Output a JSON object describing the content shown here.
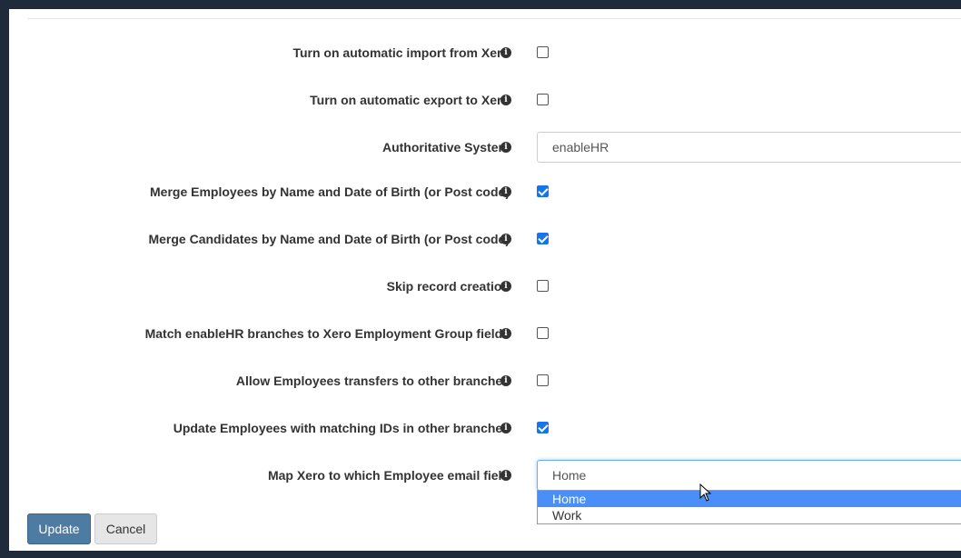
{
  "settings": {
    "rows": [
      {
        "label": "Turn on automatic import from Xero",
        "type": "checkbox",
        "checked": false
      },
      {
        "label": "Turn on automatic export to Xero",
        "type": "checkbox",
        "checked": false
      },
      {
        "label": "Authoritative System",
        "type": "text",
        "value": "enableHR"
      },
      {
        "label": "Merge Employees by Name and Date of Birth (or Post code)",
        "type": "checkbox",
        "checked": true
      },
      {
        "label": "Merge Candidates by Name and Date of Birth (or Post code)",
        "type": "checkbox",
        "checked": true
      },
      {
        "label": "Skip record creation",
        "type": "checkbox",
        "checked": false
      },
      {
        "label": "Match enableHR branches to Xero Employment Group fields",
        "type": "checkbox",
        "checked": false
      },
      {
        "label": "Allow Employees transfers to other branches",
        "type": "checkbox",
        "checked": false
      },
      {
        "label": "Update Employees with matching IDs in other branches",
        "type": "checkbox",
        "checked": true
      },
      {
        "label": "Map Xero to which Employee email field",
        "type": "select",
        "value": "Home"
      }
    ]
  },
  "dropdown": {
    "options": [
      "Home",
      "Work"
    ],
    "selected": "Home"
  },
  "buttons": {
    "update_label": "Update",
    "cancel_label": "Cancel"
  },
  "icons": {
    "info": "info-circle-icon"
  },
  "colors": {
    "checkbox_checked": "#1a73e8",
    "primary_button": "#4e7ba1",
    "dropdown_highlight": "#4a8ff7"
  }
}
